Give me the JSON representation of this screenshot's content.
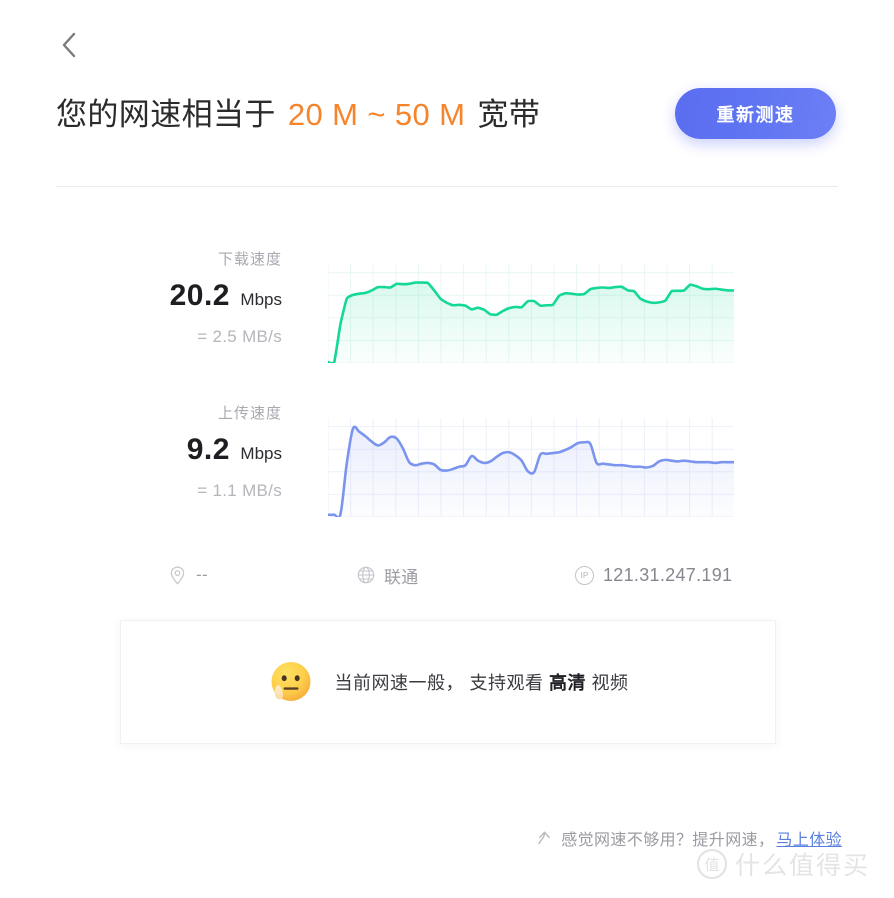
{
  "nav": {
    "back_icon": "chevron-left-icon"
  },
  "header": {
    "title_prefix": "您的网速相当于",
    "title_highlight": "20 M ~ 50 M",
    "title_suffix": "宽带",
    "retest_label": "重新测速",
    "accent_color": "#f5842b",
    "button_color": "#5b6df0"
  },
  "download": {
    "label": "下载速度",
    "value": "20.2",
    "unit": "Mbps",
    "converted": "= 2.5 MB/s",
    "line_color": "#13d897",
    "fill_color": "#13d897"
  },
  "upload": {
    "label": "上传速度",
    "value": "9.2",
    "unit": "Mbps",
    "converted": "= 1.1 MB/s",
    "line_color": "#7b95ee",
    "fill_color": "#7b95ee"
  },
  "info": {
    "location_icon": "location-pin-icon",
    "location_value": "--",
    "isp_icon": "globe-icon",
    "isp_value": "联通",
    "ip_icon": "ip-badge-icon",
    "ip_value": "121.31.247.191"
  },
  "message": {
    "emoji": "drooling-face-emoji",
    "text_before": "当前网速一般，  支持观看",
    "emphasis": "高清",
    "text_after": "视频"
  },
  "footer": {
    "icon": "speed-up-arrow-icon",
    "text": "感觉网速不够用？提升网速，",
    "link_label": "马上体验",
    "link_color": "#5b7fe0"
  },
  "watermark": {
    "badge": "值",
    "text": "什么值得买"
  },
  "chart_data": [
    {
      "type": "area",
      "name": "下载速度",
      "title": "下载速度 20.2 Mbps",
      "ylabel": "Mbps",
      "xlabel": "",
      "grid": true,
      "ylim": [
        0,
        24
      ],
      "line_color": "#13d897",
      "values": [
        0.2,
        0.2,
        9.5,
        15.6,
        16.5,
        16.8,
        17.0,
        17.6,
        18.4,
        18.4,
        18.3,
        19.2,
        19.1,
        19.2,
        19.5,
        19.5,
        19.4,
        17.6,
        15.6,
        14.6,
        14.0,
        14.1,
        13.9,
        13.0,
        13.4,
        12.9,
        11.8,
        11.7,
        12.6,
        13.3,
        13.6,
        13.5,
        15.0,
        15.0,
        13.9,
        14.0,
        14.1,
        16.3,
        16.9,
        16.8,
        16.6,
        16.7,
        17.9,
        18.2,
        18.3,
        18.2,
        18.4,
        18.5,
        17.6,
        17.4,
        15.6,
        14.9,
        14.6,
        14.7,
        15.1,
        17.4,
        17.5,
        17.6,
        19.0,
        18.6,
        18.0,
        17.9,
        18.0,
        17.8,
        17.6,
        17.6
      ]
    },
    {
      "type": "area",
      "name": "上传速度",
      "title": "上传速度 9.2 Mbps",
      "ylabel": "Mbps",
      "xlabel": "",
      "grid": true,
      "ylim": [
        0,
        13
      ],
      "line_color": "#7b95ee",
      "values": [
        0.3,
        0.3,
        0.4,
        7.0,
        11.6,
        11.2,
        10.6,
        9.9,
        9.4,
        9.8,
        10.5,
        10.3,
        9.0,
        7.2,
        6.8,
        7.0,
        7.1,
        6.9,
        6.2,
        6.1,
        6.3,
        6.6,
        6.8,
        8.0,
        7.4,
        7.1,
        7.3,
        7.9,
        8.4,
        8.5,
        8.1,
        7.4,
        6.0,
        5.9,
        8.2,
        8.3,
        8.4,
        8.5,
        8.8,
        9.2,
        9.7,
        9.8,
        9.6,
        7.1,
        7.0,
        6.9,
        6.8,
        6.8,
        6.7,
        6.6,
        6.6,
        6.5,
        6.7,
        7.3,
        7.5,
        7.4,
        7.3,
        7.4,
        7.3,
        7.2,
        7.2,
        7.2,
        7.1,
        7.2,
        7.2,
        7.2
      ]
    }
  ]
}
